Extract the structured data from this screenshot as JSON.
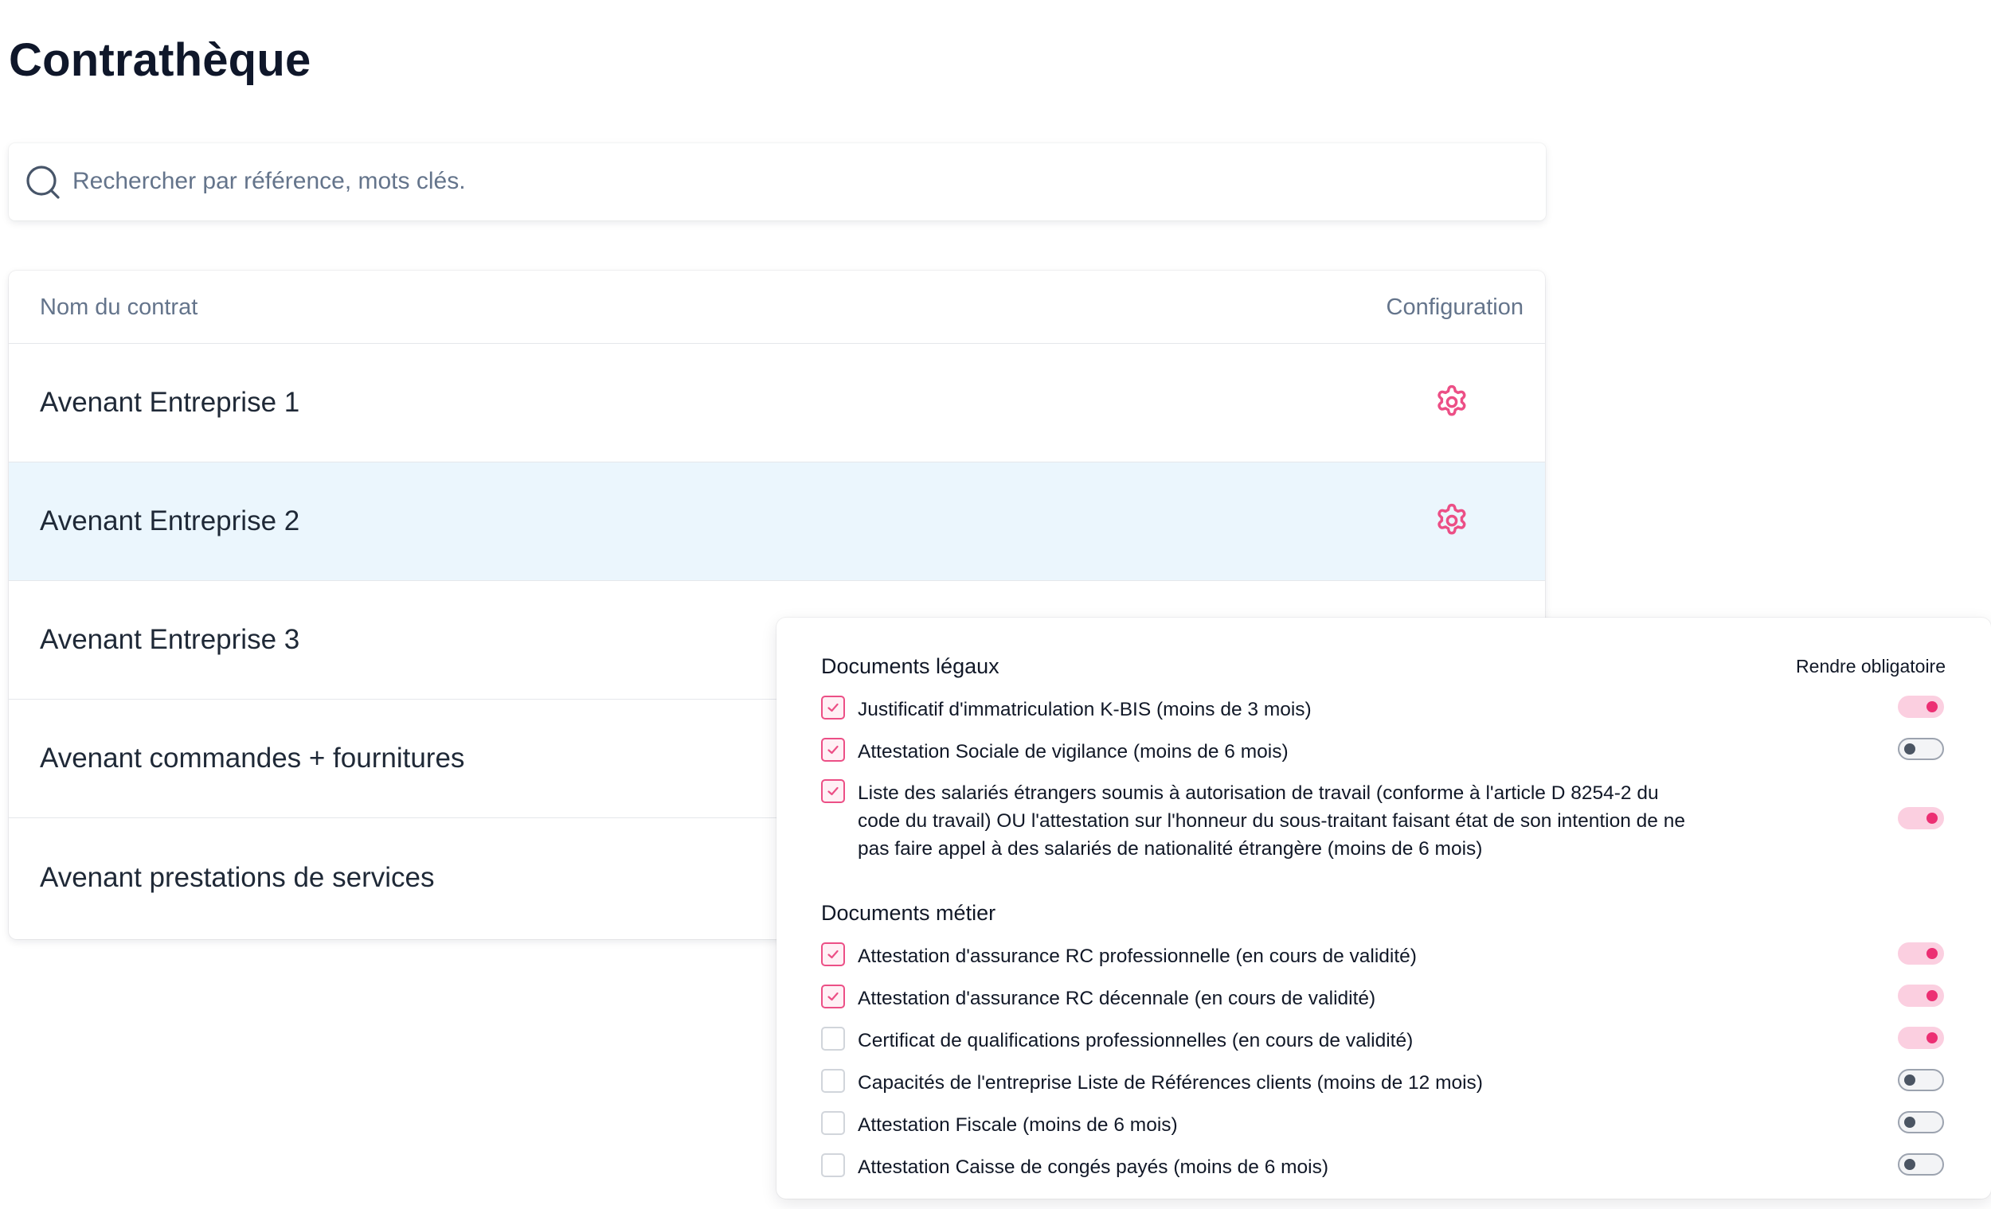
{
  "page": {
    "title": "Contrathèque"
  },
  "search": {
    "placeholder": "Rechercher par référence, mots clés.",
    "value": ""
  },
  "table": {
    "columns": {
      "name": "Nom du contrat",
      "config": "Configuration"
    },
    "rows": [
      {
        "label": "Avenant Entreprise 1",
        "selected": false
      },
      {
        "label": "Avenant Entreprise 2",
        "selected": true
      },
      {
        "label": "Avenant Entreprise 3",
        "selected": false
      },
      {
        "label": "Avenant commandes + fournitures",
        "selected": false
      },
      {
        "label": "Avenant prestations de services",
        "selected": false
      }
    ]
  },
  "config_panel": {
    "mandatory_header": "Rendre obligatoire",
    "sections": [
      {
        "title": "Documents légaux",
        "items": [
          {
            "label": "Justificatif d'immatriculation K-BIS (moins de 3 mois)",
            "checked": true,
            "mandatory": true
          },
          {
            "label": "Attestation Sociale de vigilance (moins de 6 mois)",
            "checked": true,
            "mandatory": false
          },
          {
            "label": "Liste des salariés étrangers soumis à autorisation de travail (conforme à l'article D 8254-2 du code du travail) OU l'attestation sur l'honneur du sous-traitant faisant état de son intention de ne pas faire appel à des salariés de nationalité étrangère (moins de 6 mois)",
            "checked": true,
            "mandatory": true
          }
        ]
      },
      {
        "title": "Documents métier",
        "items": [
          {
            "label": "Attestation d'assurance RC professionnelle (en cours de validité)",
            "checked": true,
            "mandatory": true
          },
          {
            "label": "Attestation d'assurance RC décennale (en cours de validité)",
            "checked": true,
            "mandatory": true
          },
          {
            "label": "Certificat de qualifications professionnelles (en cours de validité)",
            "checked": false,
            "mandatory": true
          },
          {
            "label": "Capacités de l'entreprise Liste de Références clients (moins de 12 mois)",
            "checked": false,
            "mandatory": false
          },
          {
            "label": "Attestation Fiscale (moins de 6 mois)",
            "checked": false,
            "mandatory": false
          },
          {
            "label": "Attestation Caisse de congés payés (moins de 6 mois)",
            "checked": false,
            "mandatory": false
          }
        ]
      }
    ]
  },
  "colors": {
    "accent": "#ec4f86",
    "selected_row": "#ebf6fd",
    "toggle_on_track": "#fbcfe0",
    "toggle_on_knob": "#ec2f73"
  },
  "icons": {
    "search": "search-icon",
    "config": "gear-icon",
    "check": "check-icon"
  }
}
